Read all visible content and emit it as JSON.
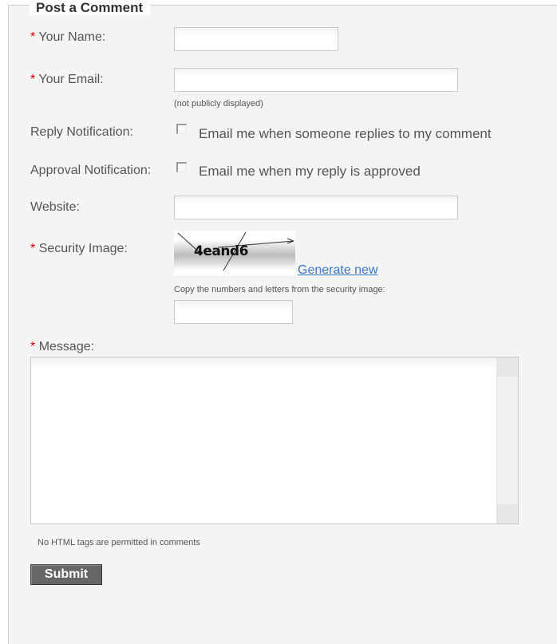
{
  "form": {
    "title": "Post a Comment",
    "required_marker": "*",
    "name_label": "Your Name:",
    "name_value": "",
    "email_label": "Your Email:",
    "email_value": "",
    "email_hint": "(not publicly displayed)",
    "reply_label": "Reply Notification:",
    "reply_checkbox_label": "Email me when someone replies to my comment",
    "reply_checked": false,
    "approval_label": "Approval Notification:",
    "approval_checkbox_label": "Email me when my reply is approved",
    "approval_checked": false,
    "website_label": "Website:",
    "website_value": "",
    "security_label": "Security Image:",
    "captcha_text": "4eand6",
    "generate_link": "Generate new",
    "captcha_hint": "Copy the numbers and letters from the security image:",
    "captcha_value": "",
    "message_label": "Message:",
    "message_value": "",
    "html_notice": "No HTML tags are permitted in comments",
    "submit_label": "Submit"
  },
  "colors": {
    "required": "#cc0000",
    "link": "#3a78c2",
    "panel_bg": "#f4f4f4",
    "submit_bg": "#666666"
  }
}
